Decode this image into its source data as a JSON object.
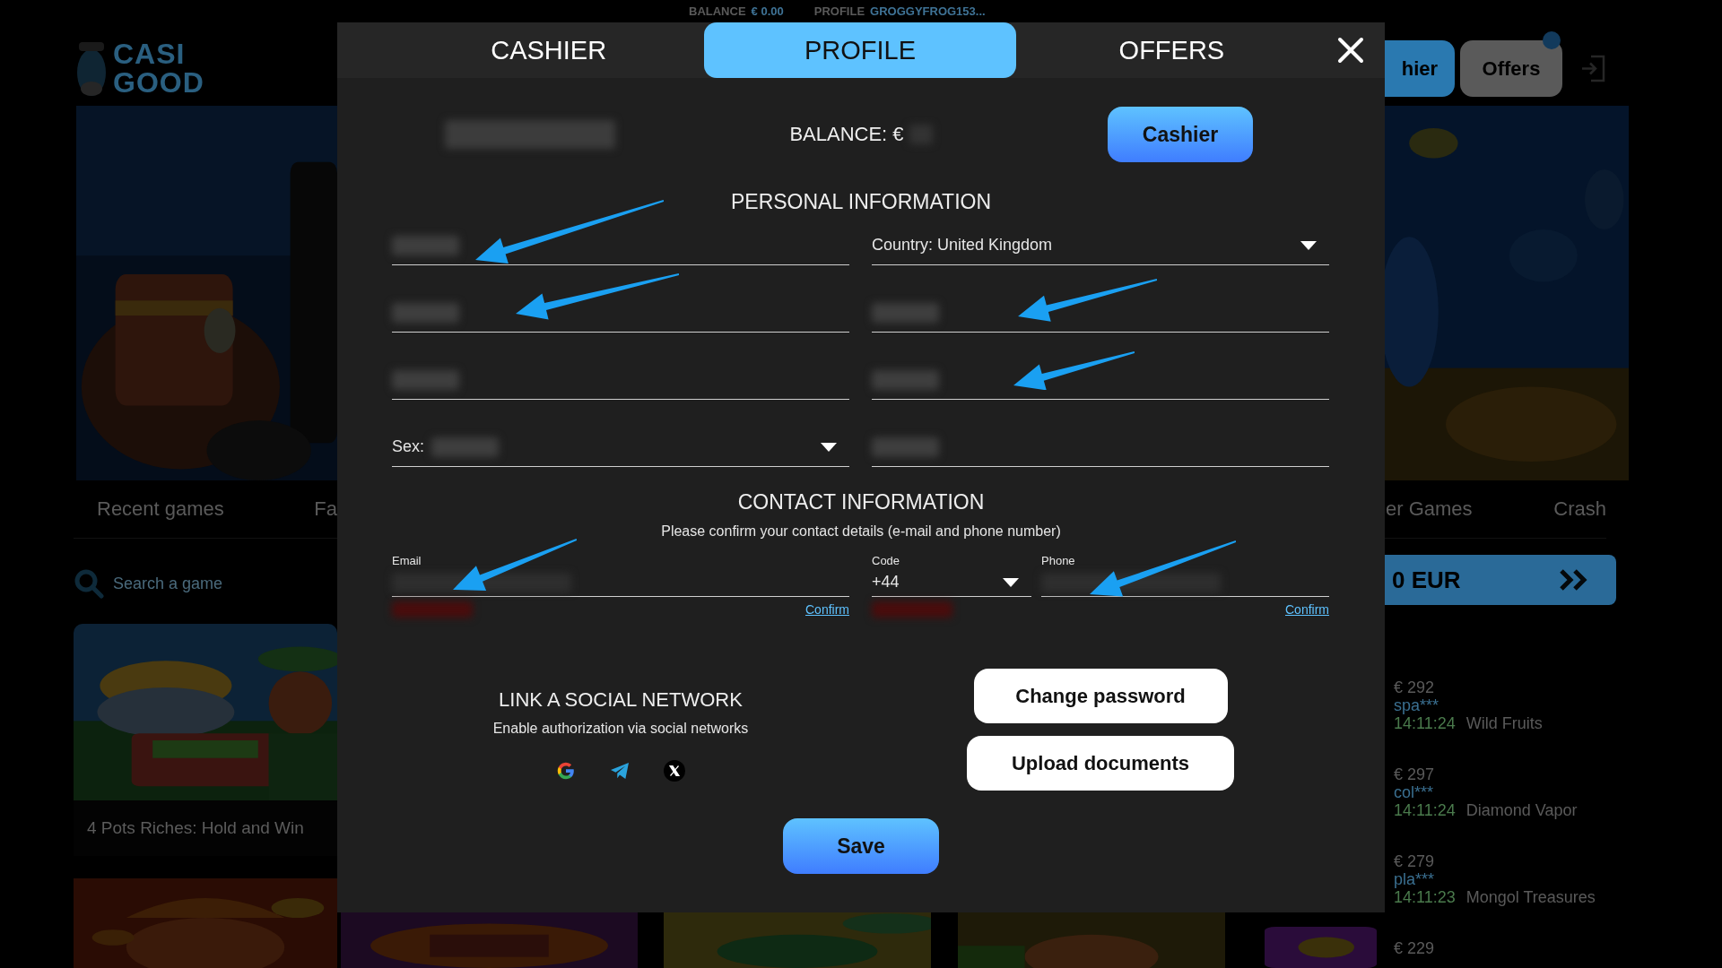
{
  "top_bar": {
    "balance_label": "BALANCE",
    "balance_value": "€ 0.00",
    "profile_label": "PROFILE",
    "profile_value": "GROGGYFROG153..."
  },
  "logo": {
    "line1": "CASI",
    "line2": "GOOD"
  },
  "header_buttons": [
    {
      "label": "hier"
    },
    {
      "label": "Offers"
    }
  ],
  "categories_left": [
    "Recent games",
    "Fa"
  ],
  "categories_right": [
    "er Games",
    "Crash"
  ],
  "search": {
    "placeholder": "Search a game"
  },
  "game_cards": [
    {
      "title": "4 Pots Riches: Hold and Win"
    }
  ],
  "promo": {
    "text": "0 EUR"
  },
  "winners": [
    {
      "amount": "€ 292",
      "user": "spa***",
      "time": "14:11:24",
      "game": "Wild Fruits"
    },
    {
      "amount": "€ 297",
      "user": "col***",
      "time": "14:11:24",
      "game": "Diamond Vapor"
    },
    {
      "amount": "€ 279",
      "user": "pla***",
      "time": "14:11:23",
      "game": "Mongol Treasures"
    },
    {
      "amount": "€ 229"
    }
  ],
  "dialog": {
    "tabs": [
      {
        "label": "CASHIER",
        "selected": false
      },
      {
        "label": "PROFILE",
        "selected": true
      },
      {
        "label": "OFFERS",
        "selected": false
      }
    ],
    "balance_label": "BALANCE: €",
    "cashier_button": "Cashier",
    "personal_title": "PERSONAL INFORMATION",
    "personal_fields": [
      {
        "redacted": true,
        "dropdown": false
      },
      {
        "value": "Country: United Kingdom",
        "redacted": false,
        "dropdown": true
      },
      {
        "redacted": true,
        "dropdown": false
      },
      {
        "redacted": true,
        "dropdown": false
      },
      {
        "redacted": true,
        "dropdown": false
      },
      {
        "redacted": true,
        "dropdown": false
      },
      {
        "value": "Sex:",
        "redacted": true,
        "dropdown": true
      },
      {
        "redacted": true,
        "dropdown": false
      }
    ],
    "contact_title": "CONTACT INFORMATION",
    "contact_note": "Please confirm your contact details (e-mail and phone number)",
    "contact_fields": [
      {
        "label": "Email",
        "redacted": true,
        "dropdown": false,
        "link": "Confirm",
        "error_redacted": true
      },
      {
        "label": "Code",
        "value": "+44",
        "redacted": false,
        "dropdown": true,
        "error_redacted": true
      },
      {
        "label": "Phone",
        "redacted": true,
        "dropdown": false,
        "link": "Confirm",
        "error_redacted": false
      }
    ],
    "social_title": "LINK A SOCIAL NETWORK",
    "social_note": "Enable authorization via social networks",
    "actions": [
      "Change password",
      "Upload documents"
    ],
    "save_button": "Save"
  }
}
